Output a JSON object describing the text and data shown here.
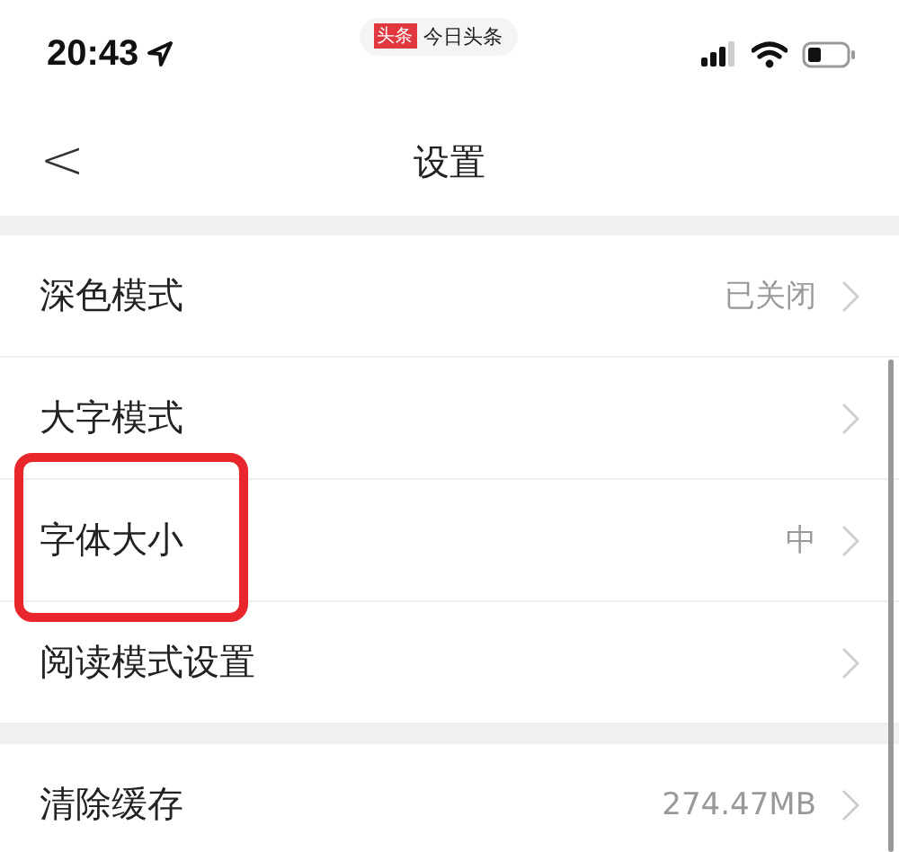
{
  "status_bar": {
    "time": "20:43",
    "app_badge": {
      "logo": "头条",
      "name": "今日头条"
    }
  },
  "nav": {
    "back": "<",
    "title": "设置"
  },
  "groups": [
    {
      "items": [
        {
          "label": "深色模式",
          "value": "已关闭",
          "highlighted": false
        },
        {
          "label": "大字模式",
          "highlighted": false
        },
        {
          "label": "字体大小",
          "value": "中",
          "highlighted": true
        },
        {
          "label": "阅读模式设置",
          "highlighted": false
        }
      ]
    },
    {
      "items": [
        {
          "label": "清除缓存",
          "value": "274.47MB",
          "highlighted": false
        }
      ]
    }
  ]
}
